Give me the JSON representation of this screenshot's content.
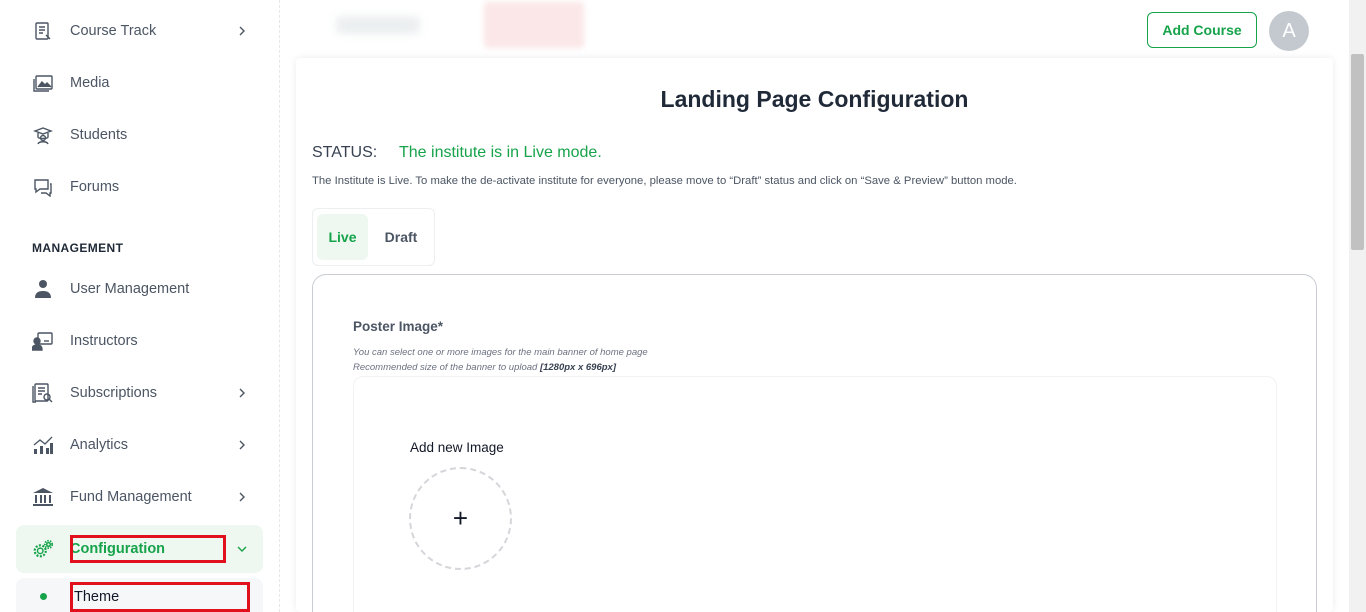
{
  "sidebar": {
    "items": [
      {
        "label": "Course Track",
        "icon": "course-track-icon",
        "has_chevron": true
      },
      {
        "label": "Media",
        "icon": "media-icon",
        "has_chevron": false
      },
      {
        "label": "Students",
        "icon": "students-icon",
        "has_chevron": false
      },
      {
        "label": "Forums",
        "icon": "forums-icon",
        "has_chevron": false
      }
    ],
    "section_title": "MANAGEMENT",
    "management_items": [
      {
        "label": "User Management",
        "icon": "user-icon",
        "has_chevron": false
      },
      {
        "label": "Instructors",
        "icon": "instructor-icon",
        "has_chevron": false
      },
      {
        "label": "Subscriptions",
        "icon": "subscriptions-icon",
        "has_chevron": true
      },
      {
        "label": "Analytics",
        "icon": "analytics-icon",
        "has_chevron": true
      },
      {
        "label": "Fund Management",
        "icon": "bank-icon",
        "has_chevron": true
      }
    ],
    "active_item": {
      "label": "Configuration",
      "icon": "gears-icon"
    },
    "sub_item": {
      "label": "Theme"
    }
  },
  "topbar": {
    "add_course_label": "Add Course",
    "avatar_initial": "A"
  },
  "main": {
    "title": "Landing Page Configuration",
    "status_label": "STATUS:",
    "status_value": "The institute is in Live mode.",
    "status_description": "The Institute is Live. To make the de-activate institute for everyone, please move to “Draft” status and click on “Save & Preview” button mode.",
    "toggle": {
      "live": "Live",
      "draft": "Draft",
      "selected": "Live"
    },
    "poster": {
      "label": "Poster Image*",
      "hint1": "You can select one or more images for the main banner of home page",
      "hint2_prefix": "Recommended size of the banner to upload ",
      "hint2_size": "[1280px x 696px]",
      "add_new_label": "Add new Image",
      "plus": "+"
    }
  },
  "colors": {
    "accent": "#16a34a",
    "active_bg": "#eef8f1",
    "highlight": "#e0101c"
  }
}
